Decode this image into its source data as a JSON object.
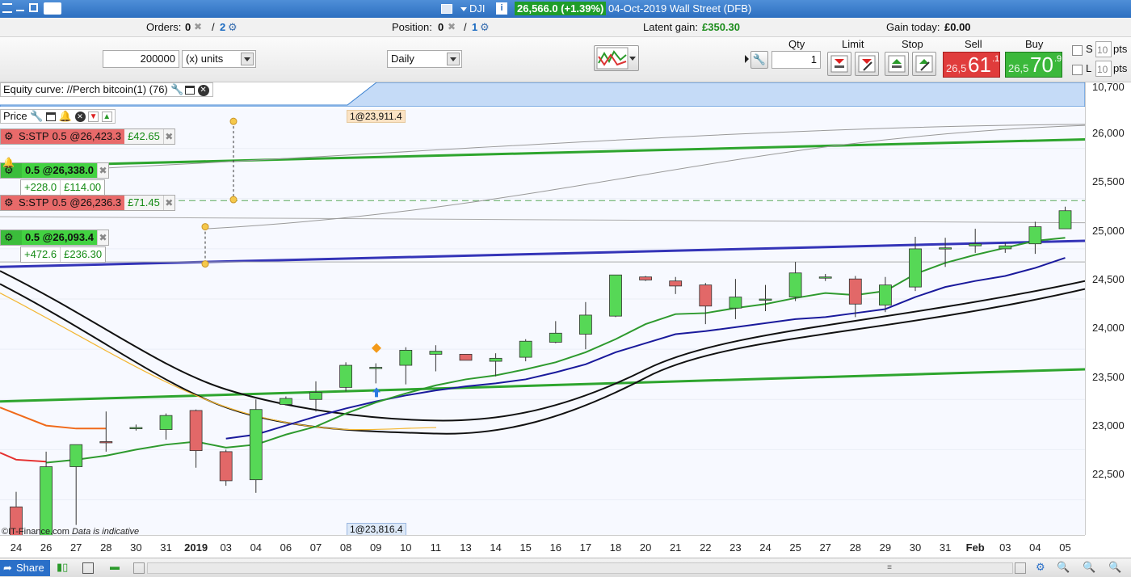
{
  "titlebar": {
    "instrument": "DJI",
    "price_badge": "26,566.0 (+1.39%)",
    "date_title": "04-Oct-2019 Wall Street (DFB)"
  },
  "infobar": {
    "orders_label": "Orders:",
    "orders_value": "0",
    "orders_count2": "2",
    "position_label": "Position:",
    "position_value": "0",
    "position_count2": "1",
    "latent_label": "Latent gain:",
    "latent_value": "£350.30",
    "gain_today_label": "Gain today:",
    "gain_today_value": "£0.00"
  },
  "toolbar": {
    "amount_value": "200000",
    "units_selected": "(x) units",
    "interval_selected": "Daily",
    "qty_label": "Qty",
    "qty_value": "1",
    "limit_label": "Limit",
    "stop_label": "Stop",
    "sell_label": "Sell",
    "buy_label": "Buy",
    "sell_prefix": "26,5",
    "sell_big": "61",
    "sell_sup": ".1",
    "buy_prefix": "26,5",
    "buy_big": "70",
    "buy_sup": ".9",
    "s_label": "S",
    "l_label": "L",
    "s_pts_value": "10",
    "l_pts_value": "10",
    "pts_label": "pts",
    "colors": {
      "sell": "#e03c3c",
      "buy": "#3bb83b"
    }
  },
  "equity": {
    "label": "Equity curve: //Perch bitcoin(1) (76)"
  },
  "price_panel": {
    "label": "Price"
  },
  "orders": [
    {
      "type": "S:STP",
      "detail": "0.5 @26,423.3",
      "gain": "£42.65"
    },
    {
      "type": "",
      "detail": "0.5 @26,338.0",
      "pts": "+228.0",
      "gain": "£114.00"
    },
    {
      "type": "S:STP",
      "detail": "0.5 @26,236.3",
      "gain": "£71.45"
    },
    {
      "type": "",
      "detail": "0.5 @26,093.4",
      "pts": "+472.6",
      "gain": "£236.30"
    }
  ],
  "annotations": {
    "top_trade": "1@23,911.4",
    "bottom_trade": "1@23,816.4",
    "copyright": "©IT-Finance.com",
    "indicative": "Data is indicative"
  },
  "yaxis": {
    "equity_label": "10,700",
    "labels": [
      "26,000",
      "25,500",
      "25,000",
      "24,500",
      "24,000",
      "23,500",
      "23,000",
      "22,500"
    ]
  },
  "chart_data": {
    "type": "candlestick",
    "title": "",
    "x": [
      "24",
      "26",
      "27",
      "28",
      "30",
      "31",
      "2019",
      "03",
      "04",
      "06",
      "07",
      "08",
      "09",
      "10",
      "11",
      "13",
      "14",
      "15",
      "16",
      "17",
      "18",
      "20",
      "21",
      "22",
      "23",
      "24",
      "25",
      "27",
      "28",
      "29",
      "30",
      "31",
      "Feb",
      "03",
      "04",
      "05"
    ],
    "ylim": [
      22150,
      26400
    ],
    "candles": [
      {
        "o": 22430,
        "h": 22580,
        "l": 21900,
        "c": 21900
      },
      {
        "o": 21900,
        "h": 22980,
        "l": 21900,
        "c": 22830
      },
      {
        "o": 22830,
        "h": 23050,
        "l": 22250,
        "c": 23050
      },
      {
        "o": 23080,
        "h": 23380,
        "l": 22980,
        "c": 23070
      },
      {
        "o": 23210,
        "h": 23250,
        "l": 23190,
        "c": 23220
      },
      {
        "o": 23200,
        "h": 23360,
        "l": 23100,
        "c": 23340
      },
      {
        "o": 23390,
        "h": 23400,
        "l": 22820,
        "c": 22990
      },
      {
        "o": 22980,
        "h": 23000,
        "l": 22640,
        "c": 22690
      },
      {
        "o": 22700,
        "h": 23500,
        "l": 22570,
        "c": 23400
      },
      {
        "o": 23450,
        "h": 23530,
        "l": 23440,
        "c": 23510
      },
      {
        "o": 23500,
        "h": 23680,
        "l": 23380,
        "c": 23570
      },
      {
        "o": 23620,
        "h": 23870,
        "l": 23580,
        "c": 23840
      },
      {
        "o": 23820,
        "h": 23860,
        "l": 23660,
        "c": 23820
      },
      {
        "o": 23840,
        "h": 24020,
        "l": 23650,
        "c": 23990
      },
      {
        "o": 23950,
        "h": 24040,
        "l": 23780,
        "c": 23980
      },
      {
        "o": 23950,
        "h": 23950,
        "l": 23900,
        "c": 23890
      },
      {
        "o": 23880,
        "h": 23960,
        "l": 23730,
        "c": 23910
      },
      {
        "o": 23920,
        "h": 24100,
        "l": 23880,
        "c": 24080
      },
      {
        "o": 24070,
        "h": 24280,
        "l": 24060,
        "c": 24160
      },
      {
        "o": 24150,
        "h": 24470,
        "l": 24000,
        "c": 24340
      },
      {
        "o": 24330,
        "h": 24740,
        "l": 24320,
        "c": 24740
      },
      {
        "o": 24720,
        "h": 24730,
        "l": 24680,
        "c": 24690
      },
      {
        "o": 24680,
        "h": 24720,
        "l": 24550,
        "c": 24630
      },
      {
        "o": 24640,
        "h": 24660,
        "l": 24250,
        "c": 24430
      },
      {
        "o": 24410,
        "h": 24700,
        "l": 24300,
        "c": 24520
      },
      {
        "o": 24500,
        "h": 24640,
        "l": 24380,
        "c": 24500
      },
      {
        "o": 24520,
        "h": 24870,
        "l": 24480,
        "c": 24760
      },
      {
        "o": 24720,
        "h": 24750,
        "l": 24680,
        "c": 24720
      },
      {
        "o": 24700,
        "h": 24730,
        "l": 24320,
        "c": 24450
      },
      {
        "o": 24440,
        "h": 24720,
        "l": 24370,
        "c": 24640
      },
      {
        "o": 24620,
        "h": 25120,
        "l": 24580,
        "c": 25000
      },
      {
        "o": 25010,
        "h": 25110,
        "l": 24820,
        "c": 25010
      },
      {
        "o": 25030,
        "h": 25200,
        "l": 24960,
        "c": 25050
      },
      {
        "o": 25000,
        "h": 25060,
        "l": 24960,
        "c": 25030
      },
      {
        "o": 25050,
        "h": 25270,
        "l": 24950,
        "c": 25220
      },
      {
        "o": 25200,
        "h": 25420,
        "l": 25200,
        "c": 25380
      }
    ],
    "series": [
      {
        "color": "#1a1a9c",
        "values": [
          null,
          null,
          null,
          null,
          null,
          null,
          null,
          23110,
          23150,
          23240,
          23330,
          23410,
          23480,
          23540,
          23590,
          23630,
          23660,
          23700,
          23770,
          23850,
          23970,
          24060,
          24150,
          24180,
          24220,
          24260,
          24300,
          24320,
          24360,
          24400,
          24520,
          24620,
          24680,
          24730,
          24810,
          24910
        ]
      },
      {
        "color": "#2e9a2e",
        "values": [
          null,
          22870,
          22900,
          22940,
          23000,
          23050,
          23080,
          23020,
          23050,
          23150,
          23230,
          23360,
          23470,
          23560,
          23640,
          23700,
          23740,
          23800,
          23870,
          23970,
          24100,
          24250,
          24350,
          24360,
          24410,
          24450,
          24510,
          24560,
          24540,
          24580,
          24750,
          24860,
          24940,
          25010,
          25080,
          25110
        ]
      }
    ]
  }
}
